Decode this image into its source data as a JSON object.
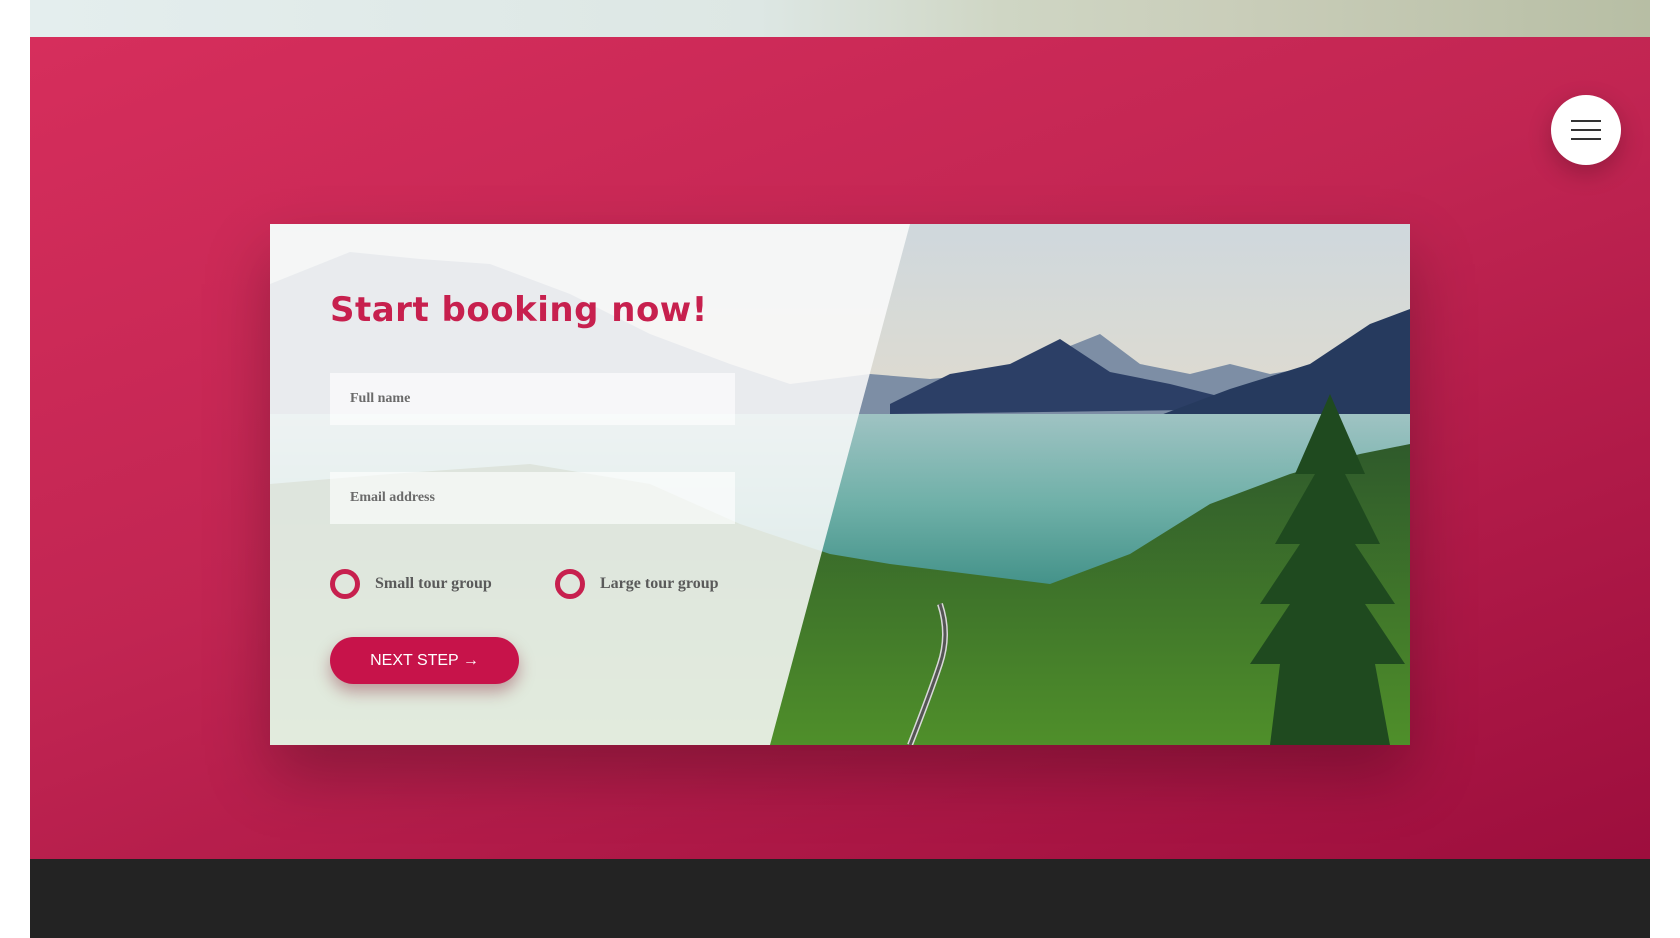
{
  "booking": {
    "title": "Start booking now!",
    "fields": {
      "full_name": {
        "placeholder": "Full name",
        "value": ""
      },
      "email": {
        "placeholder": "Email address",
        "value": ""
      }
    },
    "options": [
      {
        "label": "Small tour group",
        "selected": false
      },
      {
        "label": "Large tour group",
        "selected": false
      }
    ],
    "submit_label": "NEXT STEP →"
  },
  "nav": {
    "menu_icon": "hamburger-menu-icon"
  },
  "colors": {
    "accent": "#c7204e",
    "button": "#c7134a",
    "hero_start": "#d62e5c",
    "hero_end": "#9d0e3d",
    "footer": "#232323"
  }
}
